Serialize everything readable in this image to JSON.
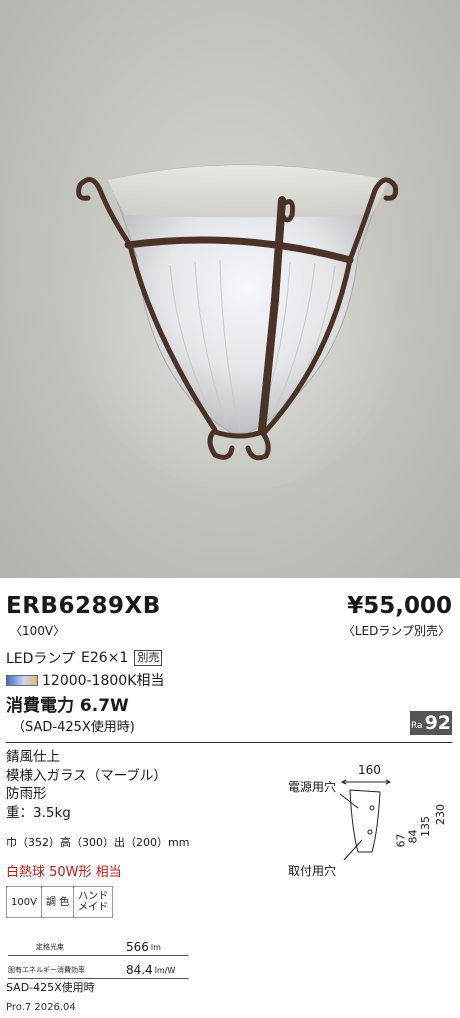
{
  "product": {
    "model": "ERB6289XB",
    "voltage": "〈100V〉",
    "price": "¥55,000",
    "price_note": "〈LEDランプ別売〉"
  },
  "lamp": {
    "label": "LEDランプ",
    "base": "E26×1",
    "sold_separately": "別売",
    "color_temp": "12000-1800K相当"
  },
  "power": {
    "label": "消費電力 6.7W",
    "note": "（SAD-425X使用時)"
  },
  "ra": {
    "label": "Ra",
    "value": "92"
  },
  "specs": [
    "錆風仕上",
    "模様入ガラス（マーブル）",
    "防雨形",
    "重：3.5kg"
  ],
  "dimensions": "巾（352）高（300）出（200）mm",
  "incandescent_equiv": "白熱球 50W形 相当",
  "badges": [
    "100V",
    "調 色",
    "ハンド\nメイド"
  ],
  "lumen": {
    "rated_label": "定格光束",
    "rated_value": "566",
    "rated_unit": "lm",
    "efficiency_label": "固有エネルギー消費効率",
    "efficiency_value": "84.4",
    "efficiency_unit": "lm/W"
  },
  "footnote": "SAD-425X使用時",
  "date": "Pro.7 2026.04",
  "diagram": {
    "power_hole": "電源用穴",
    "mount_hole": "取付用穴",
    "width": "160",
    "dims": [
      "67",
      "84",
      "135",
      "230"
    ]
  },
  "colors": {
    "incandescent_text": "#c21818",
    "ra_badge_bg": "#555555"
  }
}
